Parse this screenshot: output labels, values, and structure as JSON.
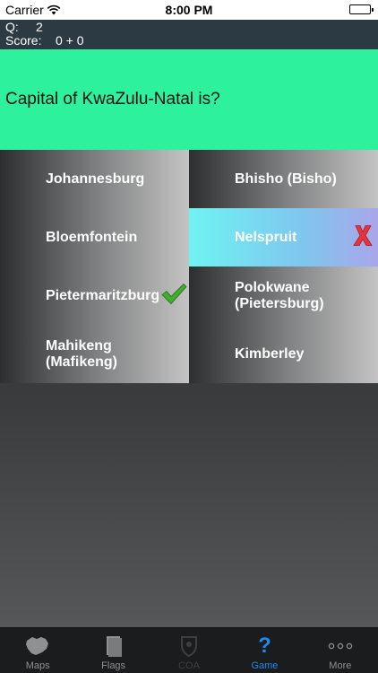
{
  "status_bar": {
    "carrier": "Carrier",
    "time": "8:00 PM"
  },
  "score_strip": {
    "q_label": "Q:",
    "q_value": "2",
    "score_label": "Score:",
    "score_value": "0 + 0"
  },
  "question": {
    "text": "Capital of KwaZulu-Natal is?"
  },
  "answers": [
    {
      "label": "Johannesburg",
      "state": "normal"
    },
    {
      "label": "Bhisho (Bisho)",
      "state": "normal"
    },
    {
      "label": "Bloemfontein",
      "state": "normal"
    },
    {
      "label": "Nelspruit",
      "state": "wrong"
    },
    {
      "label": "Pietermaritzburg",
      "state": "correct"
    },
    {
      "label": "Polokwane (Pietersburg)",
      "state": "normal"
    },
    {
      "label": "Mahikeng (Mafikeng)",
      "state": "normal"
    },
    {
      "label": "Kimberley",
      "state": "normal"
    }
  ],
  "tab_bar": {
    "tabs": [
      {
        "label": "Maps",
        "icon": "map-icon",
        "state": "normal"
      },
      {
        "label": "Flags",
        "icon": "flag-icon",
        "state": "normal"
      },
      {
        "label": "COA",
        "icon": "coat-of-arms-icon",
        "state": "disabled"
      },
      {
        "label": "Game",
        "icon": "question-mark-icon",
        "state": "active"
      },
      {
        "label": "More",
        "icon": "more-icon",
        "state": "normal"
      }
    ]
  },
  "colors": {
    "question_bg": "#2ef19e",
    "wrong_bg": "#6ff3f2",
    "correct_mark": "#3fae2a",
    "wrong_mark": "#e8353a",
    "active_tab": "#1f8af2"
  }
}
